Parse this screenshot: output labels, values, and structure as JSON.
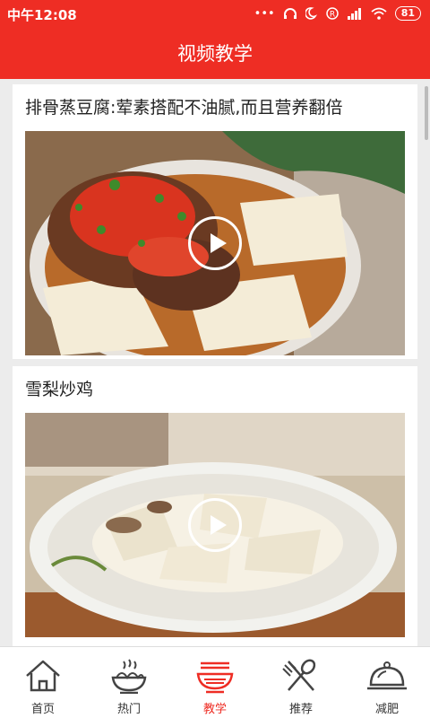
{
  "status": {
    "time": "中午12:08",
    "battery": "81"
  },
  "header": {
    "title": "视频教学"
  },
  "videos": [
    {
      "title": "排骨蒸豆腐:荤素搭配不油腻,而且营养翻倍"
    },
    {
      "title": "雪梨炒鸡"
    }
  ],
  "tabs": [
    {
      "label": "首页",
      "icon": "home-icon"
    },
    {
      "label": "热门",
      "icon": "noodle-bowl-icon"
    },
    {
      "label": "教学",
      "icon": "teaching-bowl-icon"
    },
    {
      "label": "推荐",
      "icon": "fork-spoon-icon"
    },
    {
      "label": "减肥",
      "icon": "cloche-icon"
    }
  ],
  "colors": {
    "brand": "#ee2d24",
    "active_tab": "#ee2d24"
  },
  "active_tab": "教学"
}
